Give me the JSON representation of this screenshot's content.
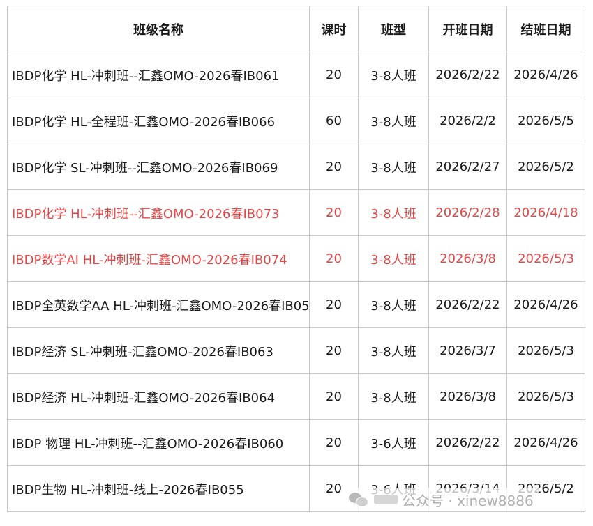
{
  "table": {
    "headers": [
      "班级名称",
      "课时",
      "班型",
      "开班日期",
      "结班日期"
    ],
    "rows": [
      {
        "name": "IBDP化学 HL-冲刺班--汇鑫OMO-2026春IB061",
        "hours": "20",
        "type": "3-8人班",
        "start": "2026/2/22",
        "end": "2026/4/26",
        "highlight": false
      },
      {
        "name": "IBDP化学 HL-全程班-汇鑫OMO-2026春IB066",
        "hours": "60",
        "type": "3-8人班",
        "start": "2026/2/2",
        "end": "2026/5/5",
        "highlight": false
      },
      {
        "name": "IBDP化学 SL-冲刺班--汇鑫OMO-2026春IB069",
        "hours": "20",
        "type": "3-8人班",
        "start": "2026/2/27",
        "end": "2026/5/2",
        "highlight": false
      },
      {
        "name": "IBDP化学 HL-冲刺班--汇鑫OMO-2026春IB073",
        "hours": "20",
        "type": "3-8人班",
        "start": "2026/2/28",
        "end": "2026/4/18",
        "highlight": true
      },
      {
        "name": "IBDP数学AI HL-冲刺班-汇鑫OMO-2026春IB074",
        "hours": "20",
        "type": "3-8人班",
        "start": "2026/3/8",
        "end": "2026/5/3",
        "highlight": true
      },
      {
        "name": "IBDP全英数学AA HL-冲刺班-汇鑫OMO-2026春IB05",
        "hours": "20",
        "type": "3-8人班",
        "start": "2026/2/22",
        "end": "2026/4/26",
        "highlight": false
      },
      {
        "name": "IBDP经济 SL-冲刺班-汇鑫OMO-2026春IB063",
        "hours": "20",
        "type": "3-8人班",
        "start": "2026/3/7",
        "end": "2026/5/3",
        "highlight": false
      },
      {
        "name": "IBDP经济 HL-冲刺班-汇鑫OMO-2026春IB064",
        "hours": "20",
        "type": "3-8人班",
        "start": "2026/3/8",
        "end": "2026/5/3",
        "highlight": false
      },
      {
        "name": "IBDP 物理 HL-冲刺班--汇鑫OMO-2026春IB060",
        "hours": "20",
        "type": "3-6人班",
        "start": "2026/2/22",
        "end": "2026/4/26",
        "highlight": false
      },
      {
        "name": "IBDP生物 HL-冲刺班-线上-2026春IB055",
        "hours": "20",
        "type": "3-6人班",
        "start": "2026/3/14",
        "end": "2026/5/2",
        "highlight": false
      }
    ]
  },
  "watermark": {
    "label": "公众号 · xinew8886",
    "icon": "wechat-icon"
  },
  "colors": {
    "highlight": "#e64545",
    "border": "#c8c8c8",
    "text": "#1a1a1a"
  }
}
